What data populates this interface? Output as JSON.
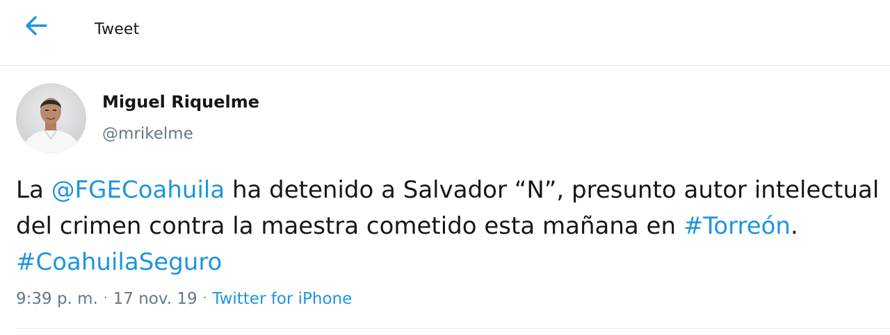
{
  "header": {
    "back_icon": "arrow-left-icon",
    "title": "Tweet",
    "accent_color": "#1b95e0"
  },
  "tweet": {
    "author": {
      "display_name": "Miguel Riquelme",
      "handle": "@mrikelme",
      "avatar_icon": "profile-photo"
    },
    "text_segments": {
      "s1": "La ",
      "mention": "@FGECoahuila",
      "s2": " ha detenido a Salvador “N”, presunto autor intelectual",
      "s3": "del crimen contra la maestra cometido esta mañana en ",
      "hashtag1": "#Torreón",
      "s4": ".",
      "hashtag2": "#CoahuilaSeguro"
    },
    "time": "9:39 p. m.",
    "separator": "·",
    "date": "17 nov. 19",
    "source": "Twitter for iPhone"
  }
}
